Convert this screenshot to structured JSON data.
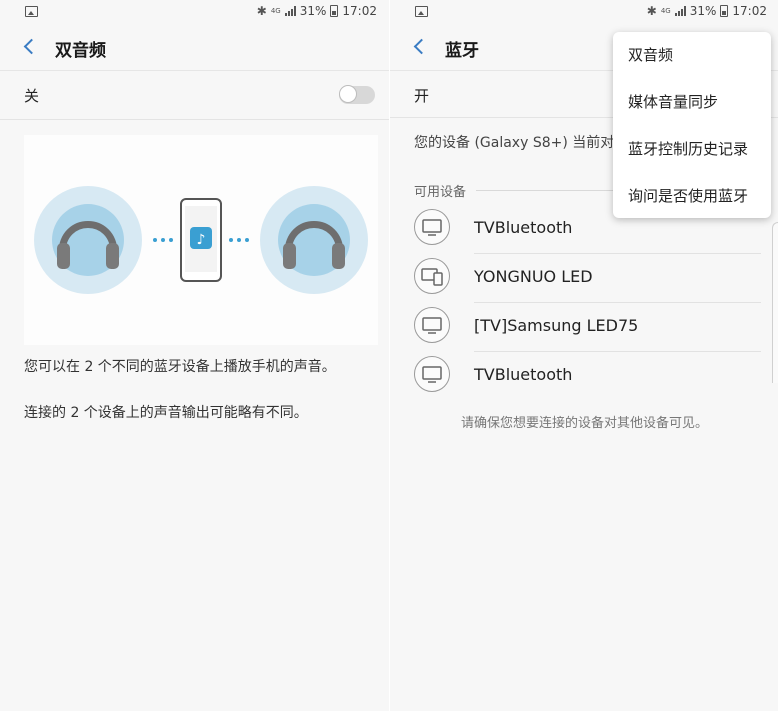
{
  "statusbar": {
    "battery": "31%",
    "time": "17:02",
    "network": "4G"
  },
  "left": {
    "title": "双音频",
    "toggle_label": "关",
    "desc1": "您可以在 2 个不同的蓝牙设备上播放手机的声音。",
    "desc2": "连接的 2 个设备上的声音输出可能略有不同。"
  },
  "right": {
    "title": "蓝牙",
    "on_label": "开",
    "info": "您的设备 (Galaxy S8+) 当前对",
    "section": "可用设备",
    "devices": [
      {
        "name": "TVBluetooth",
        "icon": "tv-icon"
      },
      {
        "name": "YONGNUO LED",
        "icon": "devices-icon"
      },
      {
        "name": "[TV]Samsung LED75",
        "icon": "tv-icon"
      },
      {
        "name": "TVBluetooth",
        "icon": "tv-icon"
      }
    ],
    "tip": "请确保您想要连接的设备对其他设备可见。"
  },
  "menu": {
    "items": [
      "双音频",
      "媒体音量同步",
      "蓝牙控制历史记录",
      "询问是否使用蓝牙"
    ]
  },
  "colors": {
    "accent": "#3a7cc3",
    "halo": "#d7e9f3",
    "headphone_ear": "#a7d2e8",
    "phone_note": "#3a9fd2"
  }
}
